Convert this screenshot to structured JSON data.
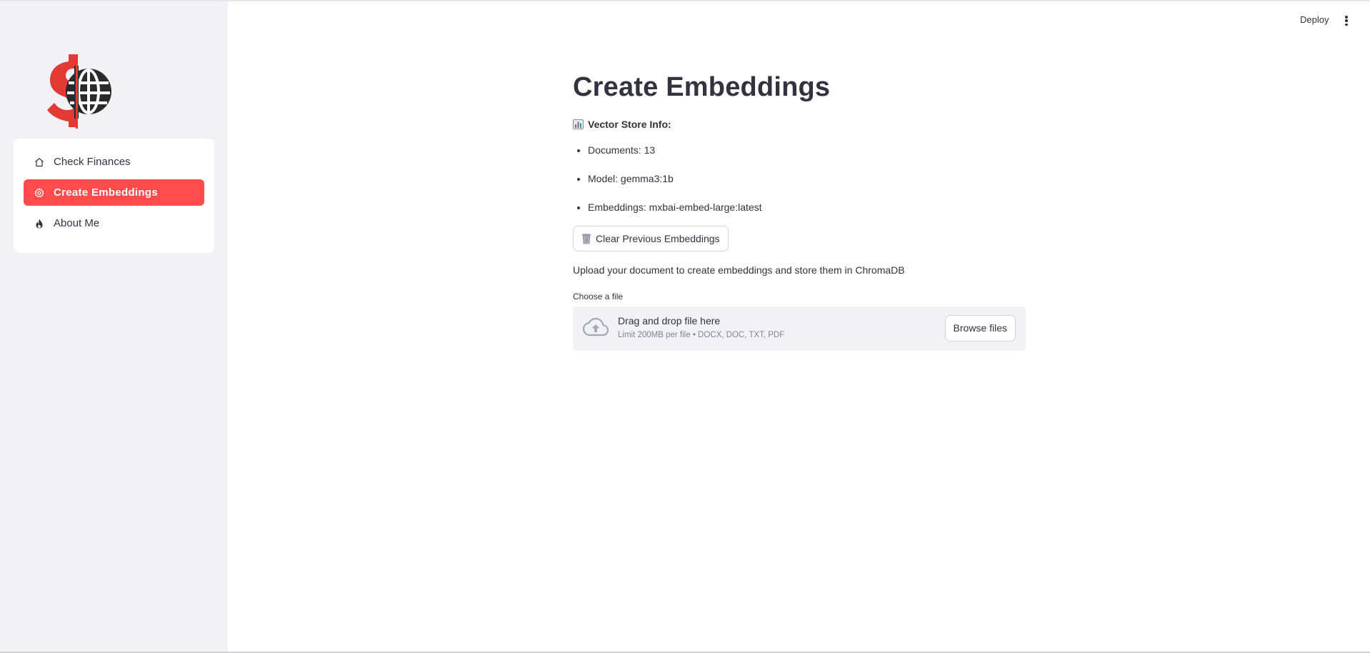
{
  "app": {
    "header": {
      "deploy_label": "Deploy",
      "menu_icon": "kebab-menu-icon"
    },
    "sidebar": {
      "logo": "dollar-globe-logo",
      "items": [
        {
          "label": "Check Finances",
          "icon": "home-icon",
          "active": false
        },
        {
          "label": "Create Embeddings",
          "icon": "gear-icon",
          "active": true
        },
        {
          "label": "About Me",
          "icon": "fire-icon",
          "active": false
        }
      ],
      "active_color": "#ff4b4b"
    },
    "main": {
      "title": "Create Embeddings",
      "info_heading": "Vector Store Info:",
      "info_icon": "bar-chart-emoji",
      "info_items": [
        "Documents: 13",
        "Model: gemma3:1b",
        "Embeddings: mxbai-embed-large:latest"
      ],
      "clear_button_label": "Clear Previous Embeddings",
      "clear_button_icon": "trash-icon",
      "upload_instruction": "Upload your document to create embeddings and store them in ChromaDB",
      "file_uploader": {
        "label": "Choose a file",
        "dropzone_title": "Drag and drop file here",
        "dropzone_limit": "Limit 200MB per file • DOCX, DOC, TXT, PDF",
        "browse_label": "Browse files",
        "icon": "cloud-upload-icon"
      }
    }
  }
}
